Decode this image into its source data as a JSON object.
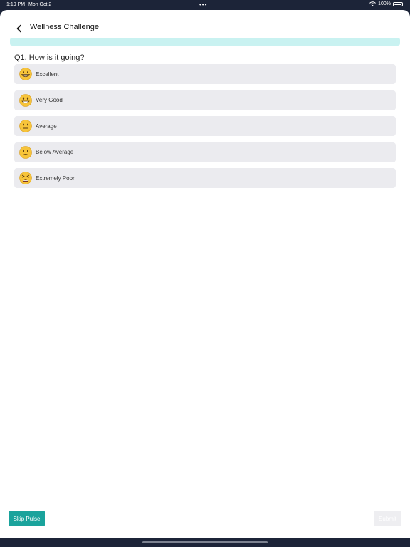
{
  "status_bar": {
    "time": "1:19 PM",
    "date": "Mon Oct 2",
    "dots": "•••",
    "battery": "100%"
  },
  "header": {
    "title": "Wellness Challenge",
    "back_icon": "chevron-left-icon"
  },
  "progress": {
    "fraction": 0.0,
    "track_color": "#c9f2f1"
  },
  "question": {
    "text": "Q1. How is it going?"
  },
  "options": [
    {
      "label": "Excellent",
      "icon": "grinning-face-icon"
    },
    {
      "label": "Very Good",
      "icon": "smiling-face-icon"
    },
    {
      "label": "Average",
      "icon": "neutral-face-icon"
    },
    {
      "label": "Below Average",
      "icon": "slightly-frowning-face-icon"
    },
    {
      "label": "Extremely Poor",
      "icon": "tired-face-icon"
    }
  ],
  "footer": {
    "skip_label": "Skip Pulse",
    "submit_label": "Submit",
    "accent_color": "#1aa39c"
  }
}
